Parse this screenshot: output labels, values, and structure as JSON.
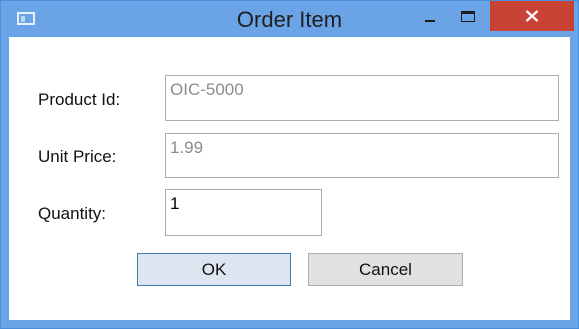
{
  "window": {
    "title": "Order Item"
  },
  "form": {
    "product_id_label": "Product Id:",
    "product_id_value": "OIC-5000",
    "unit_price_label": "Unit Price:",
    "unit_price_value": "1.99",
    "quantity_label": "Quantity:",
    "quantity_value": "1"
  },
  "buttons": {
    "ok_label": "OK",
    "cancel_label": "Cancel"
  },
  "icons": {
    "app": "window-icon",
    "minimize": "minimize-icon",
    "maximize": "maximize-icon",
    "close": "close-icon"
  },
  "colors": {
    "titlebar": "#6ba4e6",
    "close_button": "#c84336",
    "default_button_border": "#3c7fb1"
  }
}
